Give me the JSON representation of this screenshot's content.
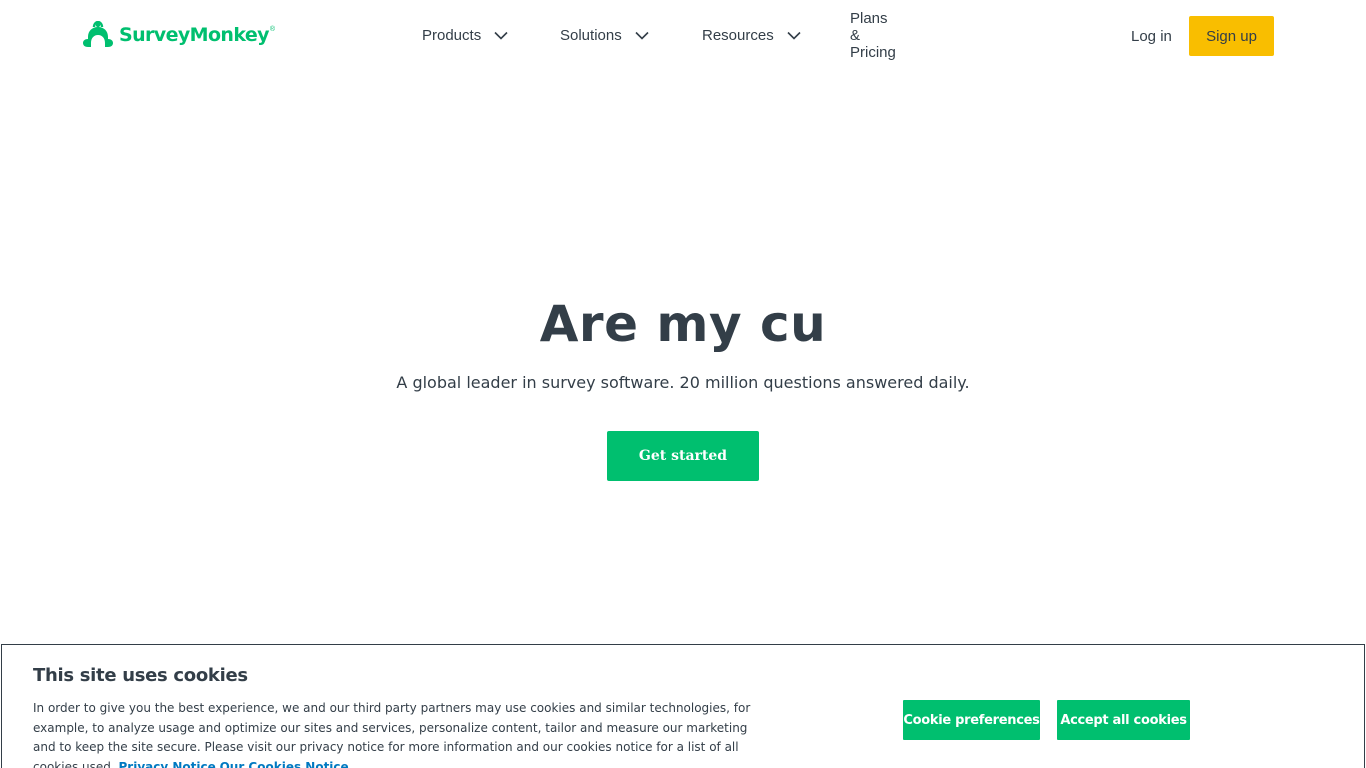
{
  "header": {
    "logo_text": "SurveyMonkey",
    "logo_reg": "®",
    "brand_color": "#00bf6f",
    "nav": [
      {
        "label": "Products",
        "icon": "chevron-down-icon"
      },
      {
        "label": "Solutions",
        "icon": "chevron-down-icon"
      },
      {
        "label": "Resources",
        "icon": "chevron-down-icon"
      },
      {
        "label": "Plans & Pricing"
      }
    ],
    "login_label": "Log in",
    "signup_label": "Sign up",
    "signup_color": "#f9be00"
  },
  "hero": {
    "title": "Are my cu",
    "subtitle": "A global leader in survey software. 20 million questions answered daily.",
    "cta_label": "Get started"
  },
  "cookie_banner": {
    "title": "This site uses cookies",
    "body": "In order to give you the best experience, we and our third party partners may use cookies and similar technologies, for example, to analyze usage and optimize our sites and services, personalize content, tailor and measure our marketing and to keep the site secure. Please visit our privacy notice for more information and our cookies notice for a list of all cookies used.",
    "privacy_link": "Privacy Notice",
    "cookies_link": "Our Cookies Notice",
    "preferences_label": "Cookie preferences",
    "accept_label": "Accept all cookies",
    "link_color": "#0079c1"
  }
}
